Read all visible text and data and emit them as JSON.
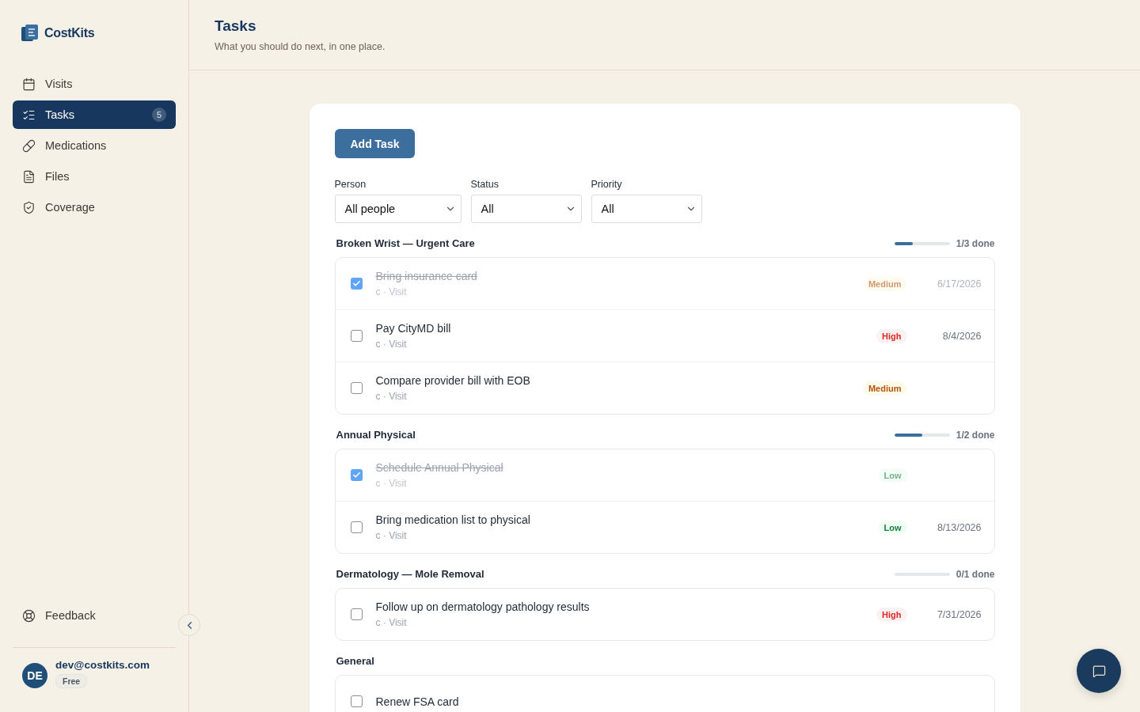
{
  "brand": {
    "name": "CostKits"
  },
  "sidebar": {
    "items": [
      {
        "label": "Visits",
        "selected": false
      },
      {
        "label": "Tasks",
        "selected": true,
        "badge": "5"
      },
      {
        "label": "Medications",
        "selected": false
      },
      {
        "label": "Files",
        "selected": false
      },
      {
        "label": "Coverage",
        "selected": false
      }
    ],
    "footer_item": {
      "label": "Feedback"
    },
    "user": {
      "initials": "DE",
      "email": "dev@costkits.com",
      "plan": "Free"
    }
  },
  "header": {
    "title": "Tasks",
    "subtitle": "What you should do next, in one place."
  },
  "add_button": "Add Task",
  "filters": [
    {
      "label": "Person",
      "value": "All people"
    },
    {
      "label": "Status",
      "value": "All"
    },
    {
      "label": "Priority",
      "value": "All"
    }
  ],
  "groups": [
    {
      "title": "Broken Wrist — Urgent Care",
      "progress": {
        "level": 0.333,
        "text": "1/3 done"
      },
      "tasks": [
        {
          "title": "Bring insurance card",
          "meta": "c · Visit",
          "checked": true,
          "priority": {
            "kind": "medium",
            "label": "Medium"
          },
          "due": "6/17/2026"
        },
        {
          "title": "Pay CityMD bill",
          "meta": "c · Visit",
          "checked": false,
          "priority": {
            "kind": "high",
            "label": "High"
          },
          "due": "8/4/2026"
        },
        {
          "title": "Compare provider bill with EOB",
          "meta": "c · Visit",
          "checked": false,
          "priority": {
            "kind": "medium",
            "label": "Medium"
          }
        }
      ]
    },
    {
      "title": "Annual Physical",
      "progress": {
        "level": 0.5,
        "text": "1/2 done"
      },
      "tasks": [
        {
          "title": "Schedule Annual Physical",
          "meta": "c · Visit",
          "checked": true,
          "priority": {
            "kind": "low",
            "label": "Low"
          }
        },
        {
          "title": "Bring medication list to physical",
          "meta": "c · Visit",
          "checked": false,
          "priority": {
            "kind": "low",
            "label": "Low"
          },
          "due": "8/13/2026"
        }
      ]
    },
    {
      "title": "Dermatology — Mole Removal",
      "progress": {
        "level": 0,
        "text": "0/1 done"
      },
      "tasks": [
        {
          "title": "Follow up on dermatology pathology results",
          "meta": "c · Visit",
          "checked": false,
          "priority": {
            "kind": "high",
            "label": "High"
          },
          "due": "7/31/2026"
        }
      ]
    },
    {
      "title": "General",
      "tasks": [
        {
          "title": "Renew FSA card",
          "checked": false
        }
      ]
    }
  ]
}
